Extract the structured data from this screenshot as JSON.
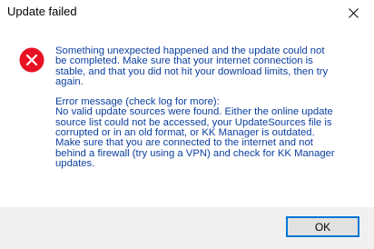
{
  "window": {
    "title": "Update failed",
    "close_icon": "close-icon"
  },
  "dialog": {
    "icon": "error-icon",
    "icon_color": "#e81123",
    "text_color": "#0a3ea0",
    "paragraph1_lines": [
      "Something unexpected happened and the update could not",
      "be completed. Make sure that your internet connection is",
      "stable, and that you did not hit your download limits, then try",
      "again."
    ],
    "paragraph2_lines": [
      "Error message (check log for more):",
      "No valid update sources were found. Either the online update",
      "source list could not be accessed, your UpdateSources file is",
      "corrupted or in an old format, or KK Manager is outdated.",
      "Make sure that you are connected to the internet and not",
      "behind a firewall (try using a VPN) and check for KK Manager",
      "updates."
    ]
  },
  "footer": {
    "ok_label": "OK",
    "background": "#f0f0f0"
  }
}
